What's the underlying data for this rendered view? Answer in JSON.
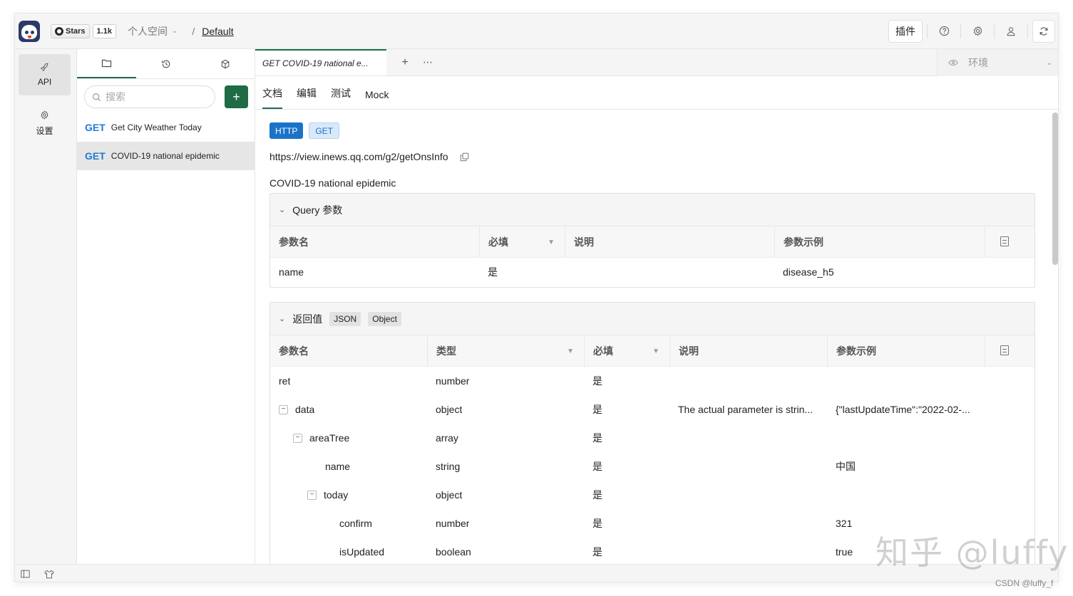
{
  "topbar": {
    "github_stars_label": "Stars",
    "github_count": "1.1k",
    "workspace": "个人空间",
    "separator": "/",
    "project": "Default",
    "plugin_button": "插件"
  },
  "leftnav": {
    "items": [
      {
        "label": "API",
        "icon": "rocket-icon"
      },
      {
        "label": "设置",
        "icon": "gear-icon"
      }
    ]
  },
  "sidebar": {
    "search_placeholder": "搜索",
    "apis": [
      {
        "method": "GET",
        "name": "Get City Weather Today"
      },
      {
        "method": "GET",
        "name": "COVID-19 national epidemic"
      }
    ]
  },
  "main": {
    "tab_title": "GET  COVID-19 national e...",
    "env_label": "环境",
    "subtabs": [
      "文档",
      "编辑",
      "测试",
      "Mock"
    ],
    "protocol_badge": "HTTP",
    "method_badge": "GET",
    "url": "https://view.inews.qq.com/g2/getOnsInfo",
    "description": "COVID-19 national epidemic",
    "query": {
      "title": "Query 参数",
      "headers": [
        "参数名",
        "必填",
        "说明",
        "参数示例"
      ],
      "rows": [
        {
          "name": "name",
          "required": "是",
          "desc": "",
          "example": "disease_h5"
        }
      ]
    },
    "response": {
      "title": "返回值",
      "tags": [
        "JSON",
        "Object"
      ],
      "headers": [
        "参数名",
        "类型",
        "必填",
        "说明",
        "参数示例"
      ],
      "rows": [
        {
          "name": "ret",
          "type": "number",
          "required": "是",
          "desc": "",
          "example": "",
          "expand": "",
          "indent": 0
        },
        {
          "name": "data",
          "type": "object",
          "required": "是",
          "desc": "The actual parameter is strin...",
          "example": "{\"lastUpdateTime\":\"2022-02-...",
          "expand": "−",
          "indent": 0
        },
        {
          "name": "areaTree",
          "type": "array",
          "required": "是",
          "desc": "",
          "example": "",
          "expand": "−",
          "indent": 1
        },
        {
          "name": "name",
          "type": "string",
          "required": "是",
          "desc": "",
          "example": "中国",
          "expand": "",
          "indent": 2
        },
        {
          "name": "today",
          "type": "object",
          "required": "是",
          "desc": "",
          "example": "",
          "expand": "−",
          "indent": 2
        },
        {
          "name": "confirm",
          "type": "number",
          "required": "是",
          "desc": "",
          "example": "321",
          "expand": "",
          "indent": 3
        },
        {
          "name": "isUpdated",
          "type": "boolean",
          "required": "是",
          "desc": "",
          "example": "true",
          "expand": "",
          "indent": 3
        }
      ]
    }
  },
  "watermark": "知乎 @luffy",
  "credit": "CSDN @luffy_f",
  "colors": {
    "accent": "#1e6b45",
    "method_get": "#1f7ad8",
    "http_badge": "#1a73c8"
  }
}
